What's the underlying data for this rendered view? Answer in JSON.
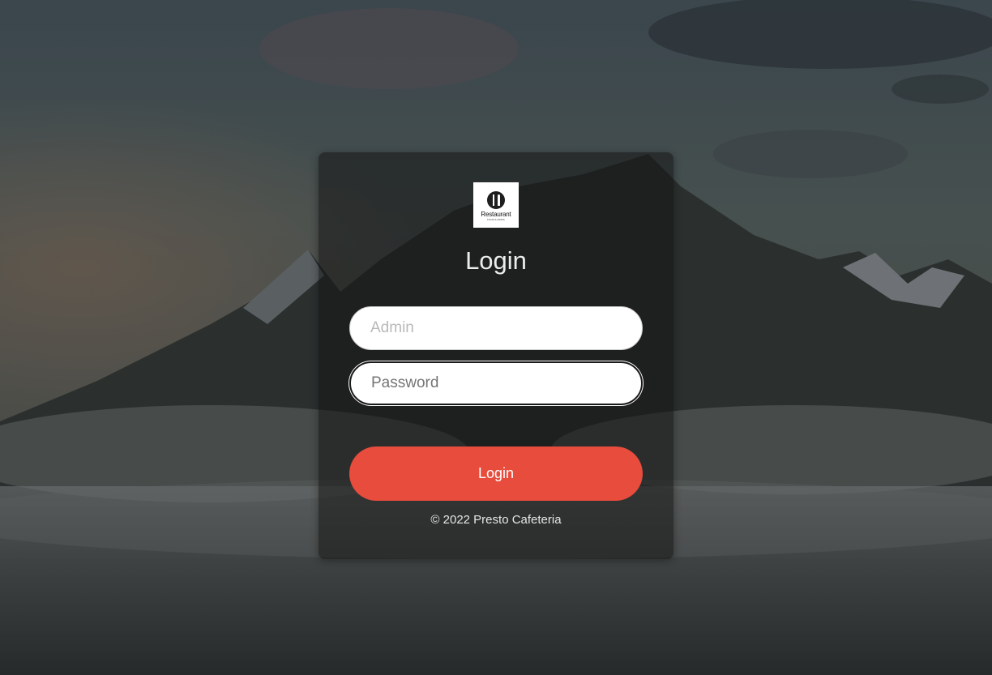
{
  "page": {
    "title": "Login"
  },
  "logo": {
    "text": "Restaurant",
    "subtext": "FOOD & DRINK",
    "icon": "fork-knife-icon"
  },
  "form": {
    "username_placeholder": "Admin",
    "username_value": "",
    "password_placeholder": "Password",
    "password_value": "",
    "submit_label": "Login"
  },
  "footer": {
    "copyright": "© 2022 Presto Cafeteria"
  },
  "colors": {
    "accent": "#e74c3c",
    "card_background": "rgba(20,20,20,0.55)",
    "input_background": "#ffffff"
  }
}
